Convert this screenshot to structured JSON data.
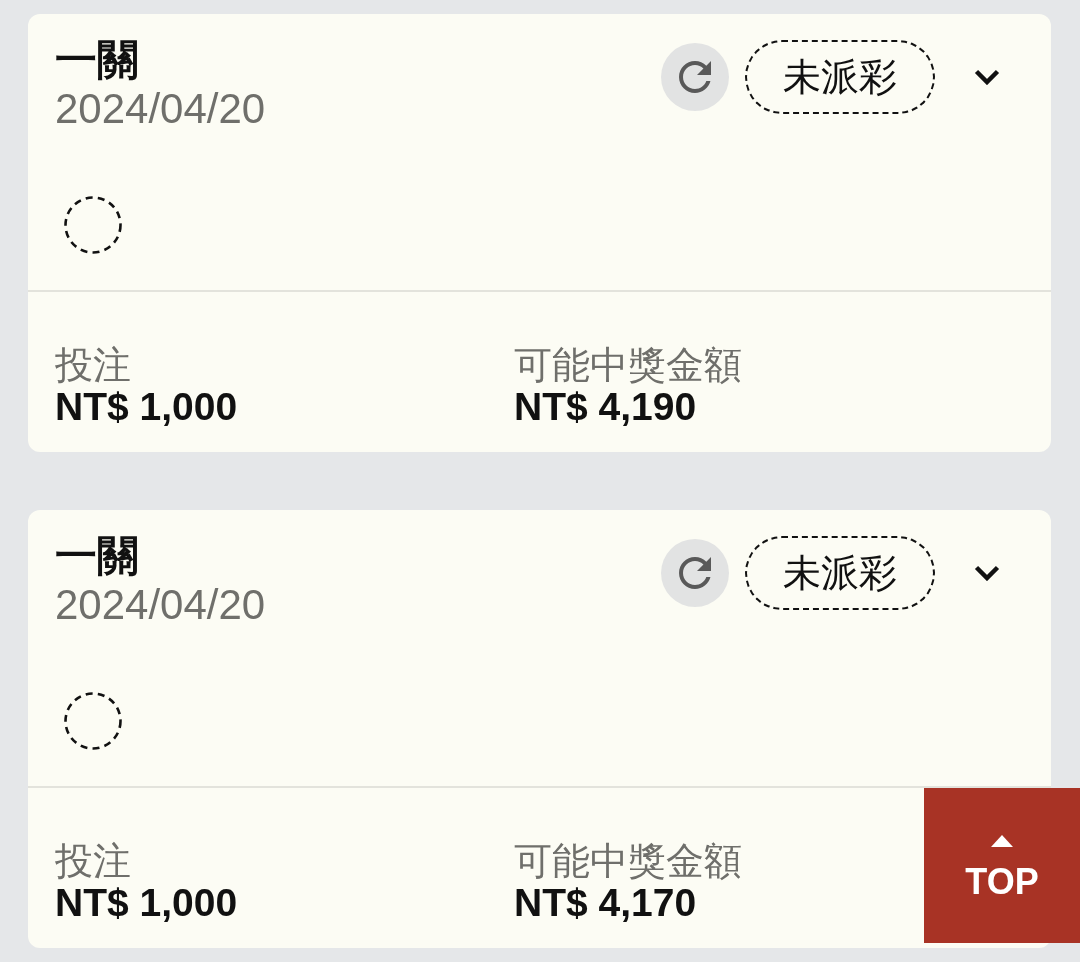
{
  "cards": [
    {
      "title": "一關",
      "date": "2024/04/20",
      "status": "未派彩",
      "expanded": false,
      "stake_label": "投注",
      "stake": "NT$ 1,000",
      "payout_label": "可能中獎金額",
      "payout": "NT$ 4,190"
    },
    {
      "title": "一關",
      "date": "2024/04/20",
      "status": "未派彩",
      "expanded": false,
      "stake_label": "投注",
      "stake": "NT$ 1,000",
      "payout_label": "可能中獎金額",
      "payout": "NT$ 4,170"
    }
  ],
  "top_button": {
    "label": "TOP"
  }
}
